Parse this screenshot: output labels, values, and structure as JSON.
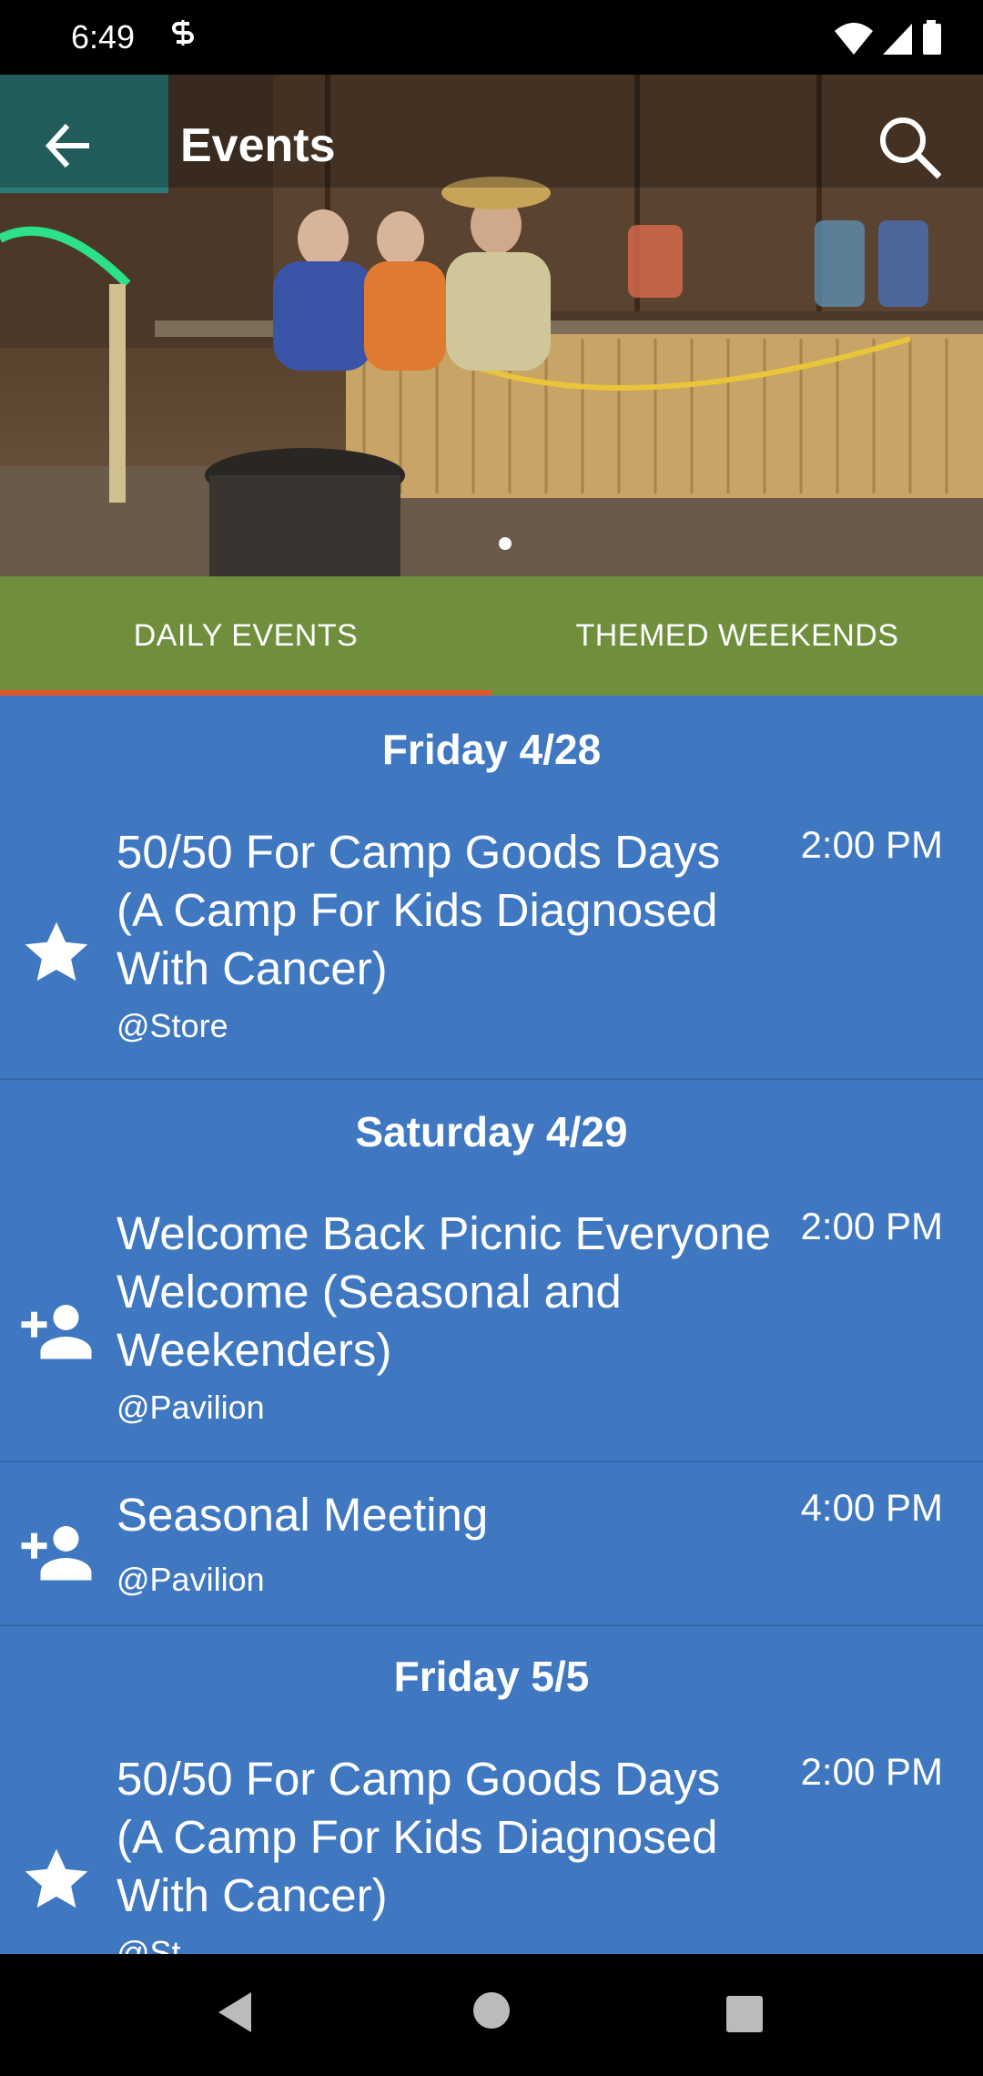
{
  "status_bar": {
    "time": "6:49"
  },
  "app_bar": {
    "title": "Events"
  },
  "tabs": [
    {
      "label": "DAILY EVENTS",
      "active": true
    },
    {
      "label": "THEMED WEEKENDS",
      "active": false
    }
  ],
  "colors": {
    "tab_bar": "#6f8f3c",
    "tab_indicator": "#e0572e",
    "list_background": "#3f78c1"
  },
  "days": [
    {
      "header": "Friday 4/28",
      "events": [
        {
          "name": "50/50 For Camp Goods Days (A Camp For Kids Diagnosed With Cancer)",
          "location": "@Store",
          "time": "2:00 PM",
          "icon": "star-icon"
        }
      ]
    },
    {
      "header": "Saturday 4/29",
      "events": [
        {
          "name": "Welcome Back Picnic Everyone Welcome (Seasonal and Weekenders)",
          "location": "@Pavilion",
          "time": "2:00 PM",
          "icon": "person-add-icon"
        },
        {
          "name": "Seasonal Meeting",
          "location": "@Pavilion",
          "time": "4:00 PM",
          "icon": "person-add-icon"
        }
      ]
    },
    {
      "header": "Friday 5/5",
      "events": [
        {
          "name": "50/50 For Camp Goods Days (A Camp For Kids Diagnosed With Cancer)",
          "location": "@St",
          "time": "2:00 PM",
          "icon": "star-icon"
        }
      ]
    }
  ]
}
